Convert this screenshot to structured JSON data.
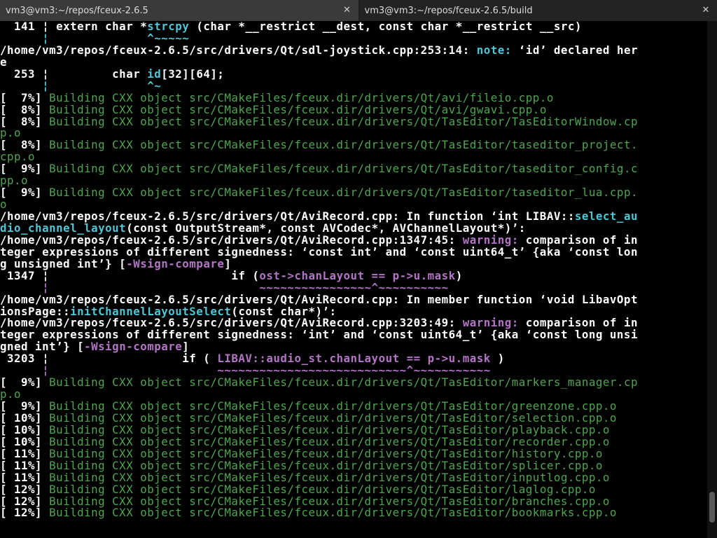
{
  "tabs": [
    {
      "title": "vm3@vm3:~/repos/fceux-2.6.5",
      "close_glyph": "✕",
      "active": false
    },
    {
      "title": "vm3@vm3:~/repos/fceux-2.6.5/build",
      "close_glyph": "✕",
      "active": true
    }
  ],
  "colors": {
    "background": "#000000",
    "white": "#ffffff",
    "green": "#4ea64e",
    "cyan": "#4ec6d6",
    "magenta": "#b474c6"
  },
  "terminal_lines": [
    [
      {
        "t": "  141 ¦ extern char *",
        "c": "w"
      },
      {
        "t": "strcpy",
        "c": "c"
      },
      {
        "t": " (char *__restrict __dest, const char *__restrict __src)",
        "c": "w"
      }
    ],
    [
      {
        "t": "      ¦              ^~~~~~",
        "c": "c"
      }
    ],
    [
      {
        "t": "/home/vm3/repos/fceux-2.6.5/src/drivers/Qt/sdl-joystick.cpp:253:14: ",
        "c": "w"
      },
      {
        "t": "note:",
        "c": "c"
      },
      {
        "t": " ‘id’ declared her",
        "c": "w"
      }
    ],
    [
      {
        "t": "e",
        "c": "w"
      }
    ],
    [
      {
        "t": "  253 ¦         char ",
        "c": "w"
      },
      {
        "t": "id",
        "c": "c"
      },
      {
        "t": "[32][64];",
        "c": "w"
      }
    ],
    [
      {
        "t": "      ¦              ^~",
        "c": "c"
      }
    ],
    [
      {
        "t": "[  7%] ",
        "c": "w"
      },
      {
        "t": "Building CXX object src/CMakeFiles/fceux.dir/drivers/Qt/avi/fileio.cpp.o",
        "c": "g"
      }
    ],
    [
      {
        "t": "[  8%] ",
        "c": "w"
      },
      {
        "t": "Building CXX object src/CMakeFiles/fceux.dir/drivers/Qt/avi/gwavi.cpp.o",
        "c": "g"
      }
    ],
    [
      {
        "t": "[  8%] ",
        "c": "w"
      },
      {
        "t": "Building CXX object src/CMakeFiles/fceux.dir/drivers/Qt/TasEditor/TasEditorWindow.cp",
        "c": "g"
      }
    ],
    [
      {
        "t": "p.o",
        "c": "g"
      }
    ],
    [
      {
        "t": "[  8%] ",
        "c": "w"
      },
      {
        "t": "Building CXX object src/CMakeFiles/fceux.dir/drivers/Qt/TasEditor/taseditor_project.",
        "c": "g"
      }
    ],
    [
      {
        "t": "cpp.o",
        "c": "g"
      }
    ],
    [
      {
        "t": "[  9%] ",
        "c": "w"
      },
      {
        "t": "Building CXX object src/CMakeFiles/fceux.dir/drivers/Qt/TasEditor/taseditor_config.c",
        "c": "g"
      }
    ],
    [
      {
        "t": "pp.o",
        "c": "g"
      }
    ],
    [
      {
        "t": "[  9%] ",
        "c": "w"
      },
      {
        "t": "Building CXX object src/CMakeFiles/fceux.dir/drivers/Qt/TasEditor/taseditor_lua.cpp.",
        "c": "g"
      }
    ],
    [
      {
        "t": "o",
        "c": "g"
      }
    ],
    [
      {
        "t": "/home/vm3/repos/fceux-2.6.5/src/drivers/Qt/AviRecord.cpp: In function ‘int LIBAV::",
        "c": "w"
      },
      {
        "t": "select_au",
        "c": "c"
      }
    ],
    [
      {
        "t": "dio_channel_layout",
        "c": "c"
      },
      {
        "t": "(const OutputStream*, const AVCodec*, AVChannelLayout*)’:",
        "c": "w"
      }
    ],
    [
      {
        "t": "/home/vm3/repos/fceux-2.6.5/src/drivers/Qt/AviRecord.cpp:1347:45: ",
        "c": "w"
      },
      {
        "t": "warning:",
        "c": "m"
      },
      {
        "t": " comparison of in",
        "c": "w"
      }
    ],
    [
      {
        "t": "teger expressions of different signedness: ‘const int’ and ‘const uint64_t’ {aka ‘const lon",
        "c": "w"
      }
    ],
    [
      {
        "t": "g unsigned int’} [",
        "c": "w"
      },
      {
        "t": "-Wsign-compare",
        "c": "m"
      },
      {
        "t": "]",
        "c": "w"
      }
    ],
    [
      {
        "t": " 1347 ¦                          if (",
        "c": "w"
      },
      {
        "t": "ost->chanLayout == p->u.mask",
        "c": "m"
      },
      {
        "t": ")",
        "c": "w"
      }
    ],
    [
      {
        "t": "      ¦                              ~~~~~~~~~~~~~~~~^~~~~~~~~~~",
        "c": "m"
      }
    ],
    [
      {
        "t": "/home/vm3/repos/fceux-2.6.5/src/drivers/Qt/AviRecord.cpp: In member function ‘void LibavOpt",
        "c": "w"
      }
    ],
    [
      {
        "t": "ionsPage::",
        "c": "w"
      },
      {
        "t": "initChannelLayoutSelect",
        "c": "c"
      },
      {
        "t": "(const char*)’:",
        "c": "w"
      }
    ],
    [
      {
        "t": "/home/vm3/repos/fceux-2.6.5/src/drivers/Qt/AviRecord.cpp:3203:49: ",
        "c": "w"
      },
      {
        "t": "warning:",
        "c": "m"
      },
      {
        "t": " comparison of in",
        "c": "w"
      }
    ],
    [
      {
        "t": "teger expressions of different signedness: ‘int’ and ‘const uint64_t’ {aka ‘const long unsi",
        "c": "w"
      }
    ],
    [
      {
        "t": "gned int’} [",
        "c": "w"
      },
      {
        "t": "-Wsign-compare",
        "c": "m"
      },
      {
        "t": "]",
        "c": "w"
      }
    ],
    [
      {
        "t": " 3203 ¦                   if ( ",
        "c": "w"
      },
      {
        "t": "LIBAV::audio_st.chanLayout == p->u.mask",
        "c": "m"
      },
      {
        "t": " )",
        "c": "w"
      }
    ],
    [
      {
        "t": "      ¦                        ~~~~~~~~~~~~~~~~~~~~~~~~~~~^~~~~~~~~~~~",
        "c": "m"
      }
    ],
    [
      {
        "t": "[  9%] ",
        "c": "w"
      },
      {
        "t": "Building CXX object src/CMakeFiles/fceux.dir/drivers/Qt/TasEditor/markers_manager.cp",
        "c": "g"
      }
    ],
    [
      {
        "t": "p.o",
        "c": "g"
      }
    ],
    [
      {
        "t": "[  9%] ",
        "c": "w"
      },
      {
        "t": "Building CXX object src/CMakeFiles/fceux.dir/drivers/Qt/TasEditor/greenzone.cpp.o",
        "c": "g"
      }
    ],
    [
      {
        "t": "[ 10%] ",
        "c": "w"
      },
      {
        "t": "Building CXX object src/CMakeFiles/fceux.dir/drivers/Qt/TasEditor/selection.cpp.o",
        "c": "g"
      }
    ],
    [
      {
        "t": "[ 10%] ",
        "c": "w"
      },
      {
        "t": "Building CXX object src/CMakeFiles/fceux.dir/drivers/Qt/TasEditor/playback.cpp.o",
        "c": "g"
      }
    ],
    [
      {
        "t": "[ 10%] ",
        "c": "w"
      },
      {
        "t": "Building CXX object src/CMakeFiles/fceux.dir/drivers/Qt/TasEditor/recorder.cpp.o",
        "c": "g"
      }
    ],
    [
      {
        "t": "[ 11%] ",
        "c": "w"
      },
      {
        "t": "Building CXX object src/CMakeFiles/fceux.dir/drivers/Qt/TasEditor/history.cpp.o",
        "c": "g"
      }
    ],
    [
      {
        "t": "[ 11%] ",
        "c": "w"
      },
      {
        "t": "Building CXX object src/CMakeFiles/fceux.dir/drivers/Qt/TasEditor/splicer.cpp.o",
        "c": "g"
      }
    ],
    [
      {
        "t": "[ 11%] ",
        "c": "w"
      },
      {
        "t": "Building CXX object src/CMakeFiles/fceux.dir/drivers/Qt/TasEditor/inputlog.cpp.o",
        "c": "g"
      }
    ],
    [
      {
        "t": "[ 12%] ",
        "c": "w"
      },
      {
        "t": "Building CXX object src/CMakeFiles/fceux.dir/drivers/Qt/TasEditor/laglog.cpp.o",
        "c": "g"
      }
    ],
    [
      {
        "t": "[ 12%] ",
        "c": "w"
      },
      {
        "t": "Building CXX object src/CMakeFiles/fceux.dir/drivers/Qt/TasEditor/branches.cpp.o",
        "c": "g"
      }
    ],
    [
      {
        "t": "[ 12%] ",
        "c": "w"
      },
      {
        "t": "Building CXX object src/CMakeFiles/fceux.dir/drivers/Qt/TasEditor/bookmarks.cpp.o",
        "c": "g"
      }
    ]
  ]
}
